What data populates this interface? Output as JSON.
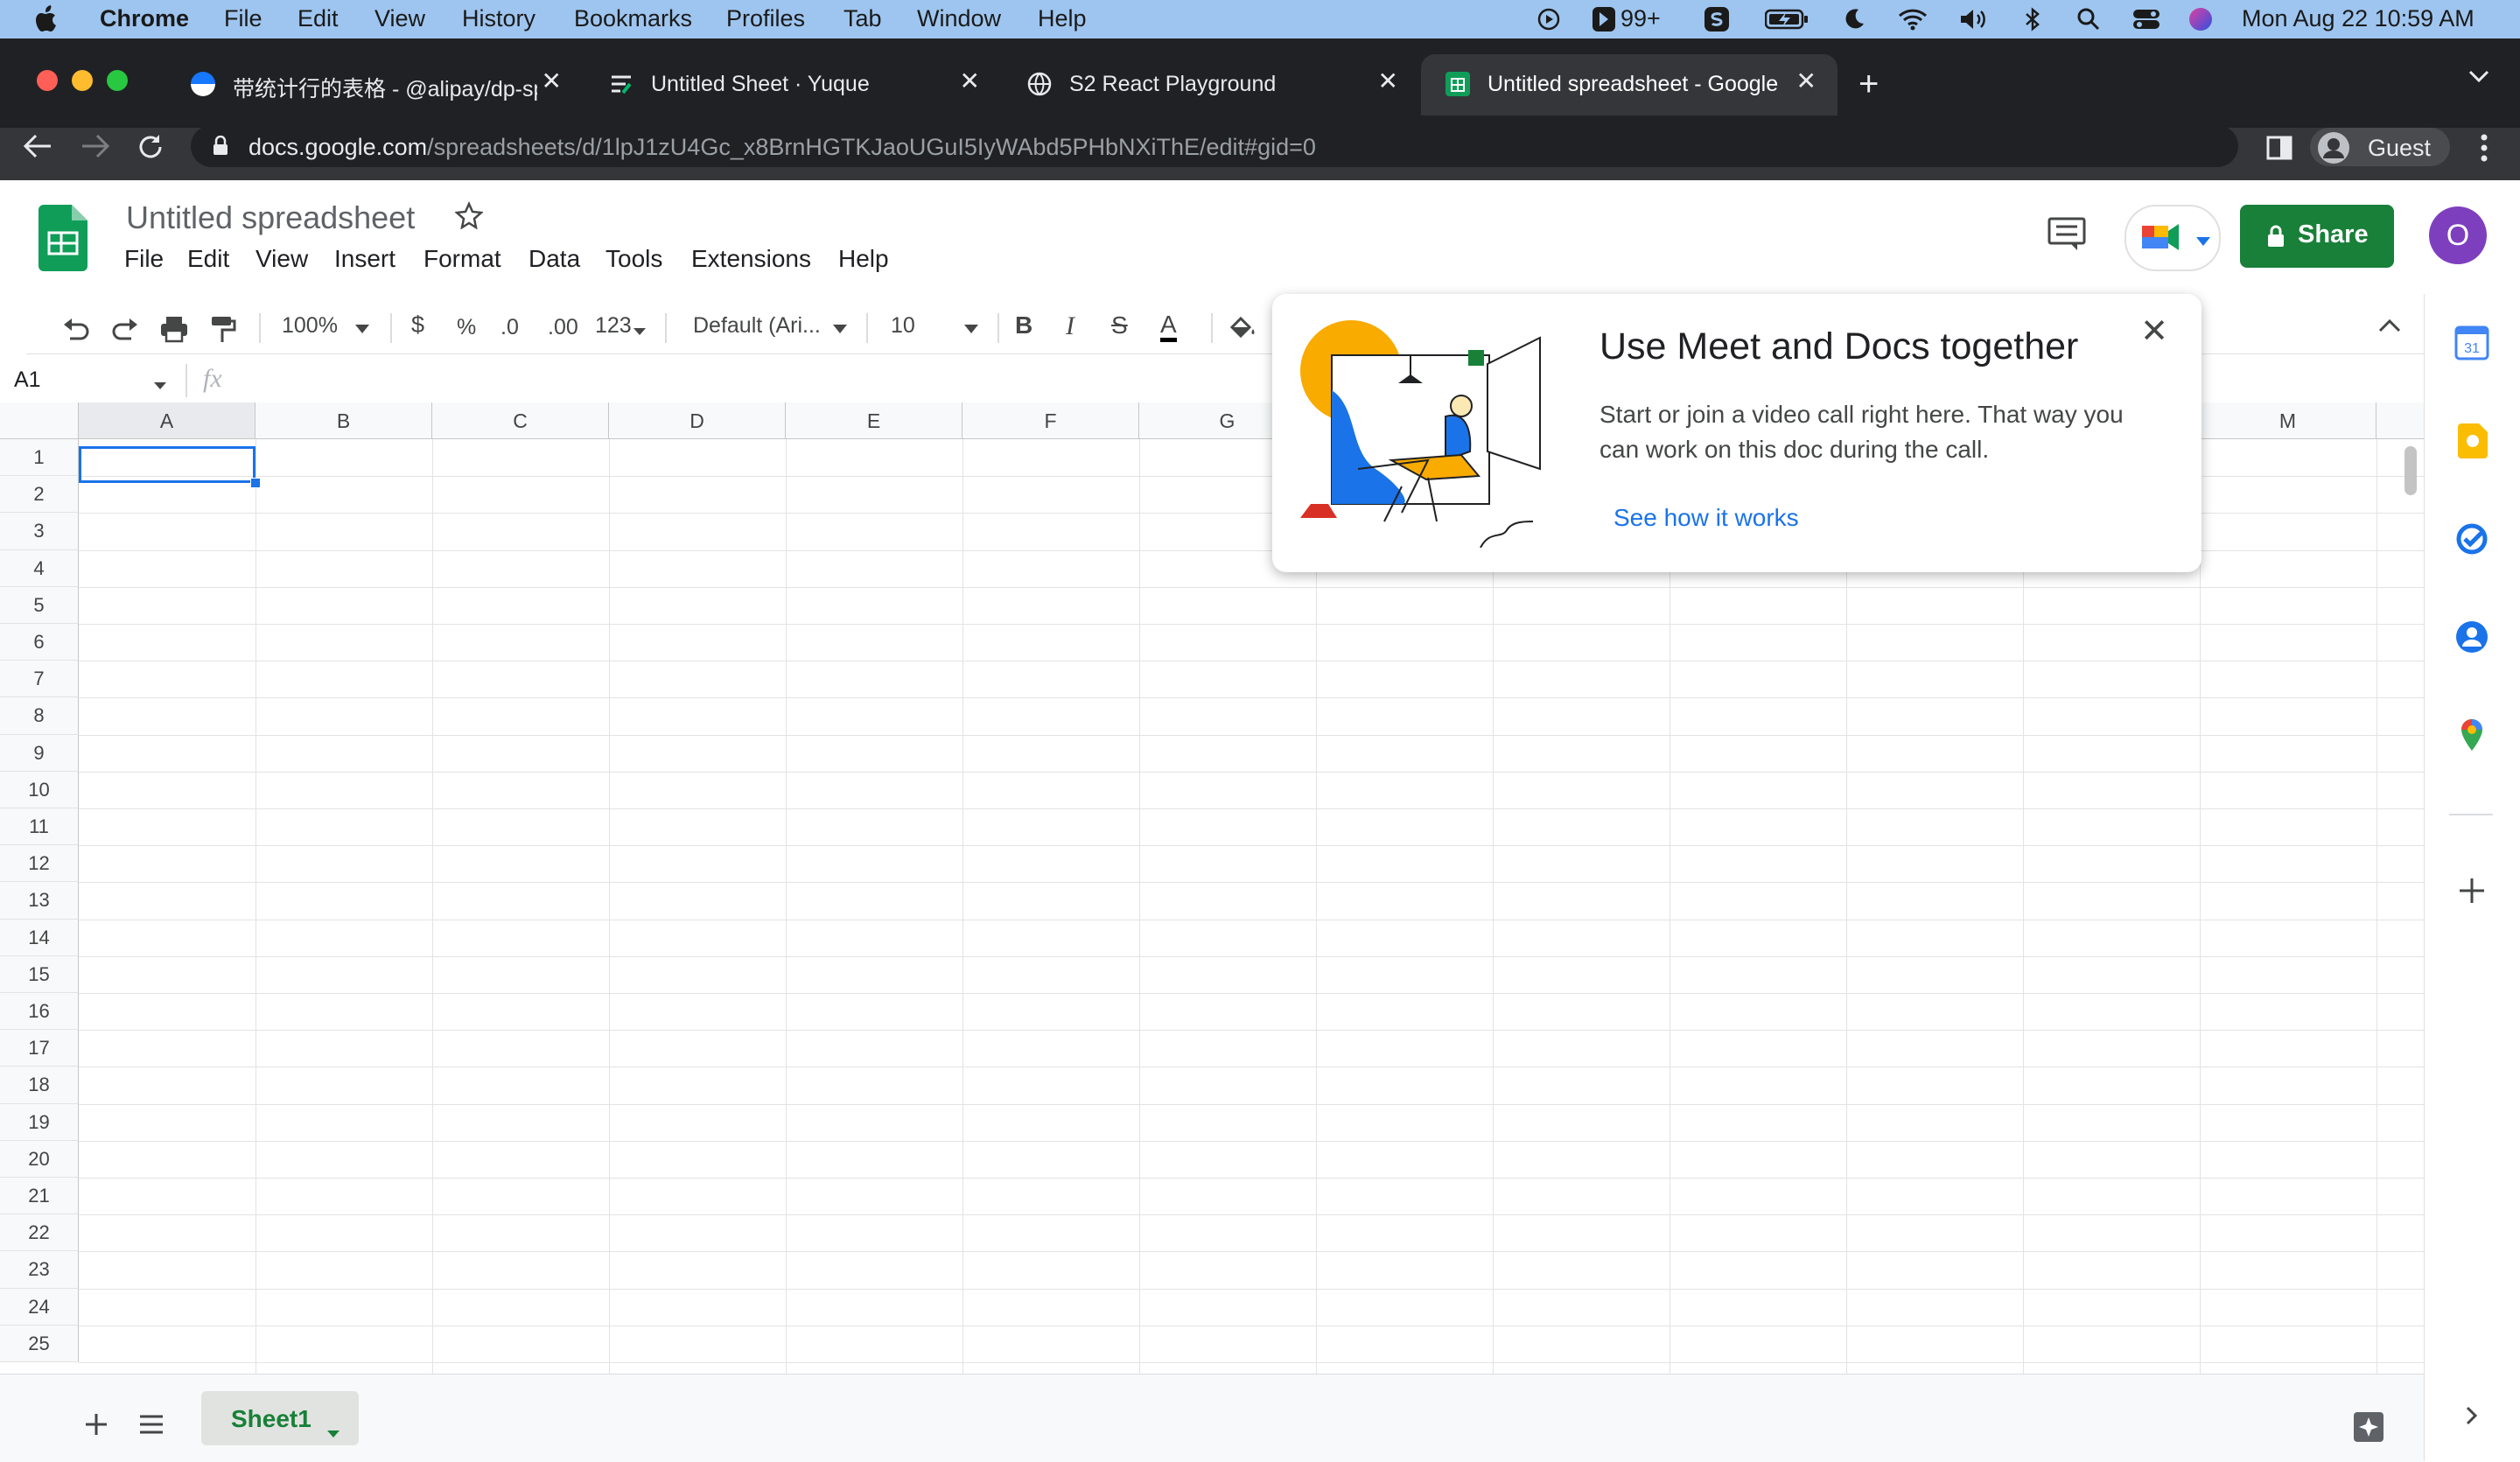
{
  "macos": {
    "app_name": "Chrome",
    "menus": [
      "File",
      "Edit",
      "View",
      "History",
      "Bookmarks",
      "Profiles",
      "Tab",
      "Window",
      "Help"
    ],
    "badge_count": "99+",
    "clock": "Mon Aug 22  10:59 AM"
  },
  "tabs": [
    {
      "title": "带统计行的表格 - @alipay/dp-sp",
      "active": false
    },
    {
      "title": "Untitled Sheet · Yuque",
      "active": false
    },
    {
      "title": "S2 React Playground",
      "active": false
    },
    {
      "title": "Untitled spreadsheet - Google",
      "active": true
    }
  ],
  "omnibox": {
    "domain": "docs.google.com",
    "path": "/spreadsheets/d/1lpJ1zU4Gc_x8BrnHGTKJaoUGuI5IyWAbd5PHbNXiThE/edit#gid=0"
  },
  "profile": {
    "label": "Guest"
  },
  "doc": {
    "title": "Untitled spreadsheet",
    "menus": [
      "File",
      "Edit",
      "View",
      "Insert",
      "Format",
      "Data",
      "Tools",
      "Extensions",
      "Help"
    ],
    "share_label": "Share",
    "avatar_letter": "O"
  },
  "toolbar": {
    "zoom": "100%",
    "currency": "$",
    "percent": "%",
    "decrease_decimal": ".0",
    "increase_decimal": ".00",
    "number_format": "123",
    "font": "Default (Ari...",
    "font_size": "10",
    "bold": "B",
    "italic": "I",
    "strikethrough": "S",
    "text_color": "A"
  },
  "formula_bar": {
    "cell_ref": "A1",
    "fx": "fx"
  },
  "grid": {
    "columns": [
      "A",
      "B",
      "C",
      "D",
      "E",
      "F",
      "G",
      "M"
    ],
    "rows": [
      "1",
      "2",
      "3",
      "4",
      "5",
      "6",
      "7",
      "8",
      "9",
      "10",
      "11",
      "12",
      "13",
      "14",
      "15",
      "16",
      "17",
      "18",
      "19",
      "20",
      "21",
      "22",
      "23",
      "24",
      "25"
    ]
  },
  "popup": {
    "title": "Use Meet and Docs together",
    "body": "Start or join a video call right here. That way you can work on this doc during the call.",
    "link": "See how it works"
  },
  "sheets": {
    "active": "Sheet1"
  },
  "colors": {
    "brand_green": "#188038",
    "link_blue": "#1a73e8",
    "avatar_purple": "#7e3fbf"
  }
}
